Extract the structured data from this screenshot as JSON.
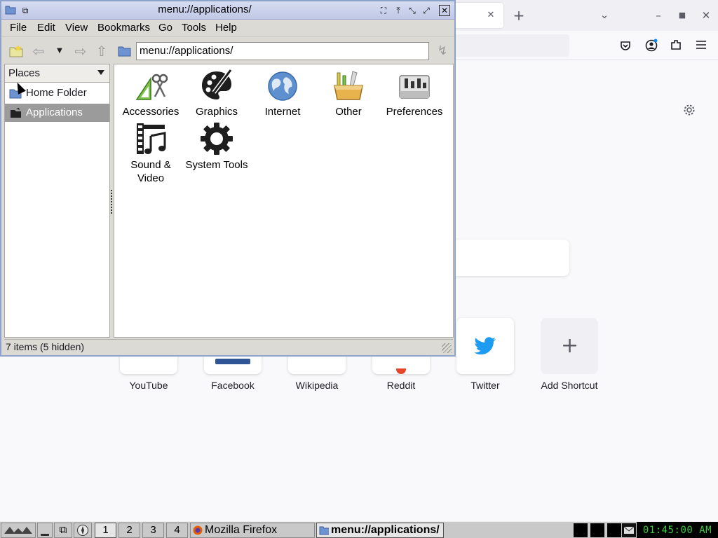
{
  "firefox": {
    "tile_labels": [
      "YouTube",
      "Facebook",
      "Wikipedia",
      "Reddit",
      "Twitter",
      "Add Shortcut"
    ]
  },
  "file_manager": {
    "title": "menu://applications/",
    "menu": [
      "File",
      "Edit",
      "View",
      "Bookmarks",
      "Go",
      "Tools",
      "Help"
    ],
    "location": "menu://applications/",
    "side_panel": {
      "mode": "Places",
      "items": [
        {
          "label": "Home Folder",
          "selected": false
        },
        {
          "label": "Applications",
          "selected": true
        }
      ]
    },
    "apps": [
      "Accessories",
      "Graphics",
      "Internet",
      "Other",
      "Preferences",
      "Sound & Video",
      "System Tools"
    ],
    "status": "7 items (5 hidden)"
  },
  "taskbar": {
    "desktops": [
      "1",
      "2",
      "3",
      "4"
    ],
    "current_desktop": "1",
    "tasks": [
      {
        "label": "Mozilla Firefox",
        "active": false
      },
      {
        "label": "menu://applications/",
        "active": true
      }
    ],
    "clock": "01:45:00 AM"
  }
}
